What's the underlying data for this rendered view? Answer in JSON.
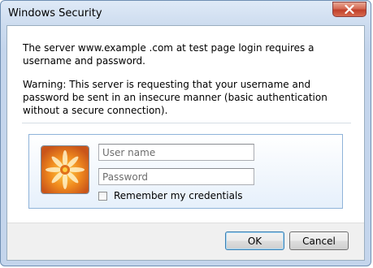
{
  "window": {
    "title": "Windows Security"
  },
  "icons": {
    "close": "close-icon",
    "avatar": "flower-avatar-icon"
  },
  "message": {
    "line1": "The server www.example .com at test page login requires a username and password.",
    "warning": "Warning: This server is requesting that your username and password be sent in an insecure manner (basic authentication without a secure connection)."
  },
  "credentials": {
    "username_placeholder": "User name",
    "username_value": "",
    "password_placeholder": "Password",
    "password_value": "",
    "remember_label": "Remember my credentials",
    "remember_checked": false
  },
  "buttons": {
    "ok": "OK",
    "cancel": "Cancel"
  },
  "colors": {
    "frame": "#c4d5ec",
    "close_button": "#c0402a",
    "panel_border": "#8fb3d9",
    "footer": "#f0f0f0"
  }
}
